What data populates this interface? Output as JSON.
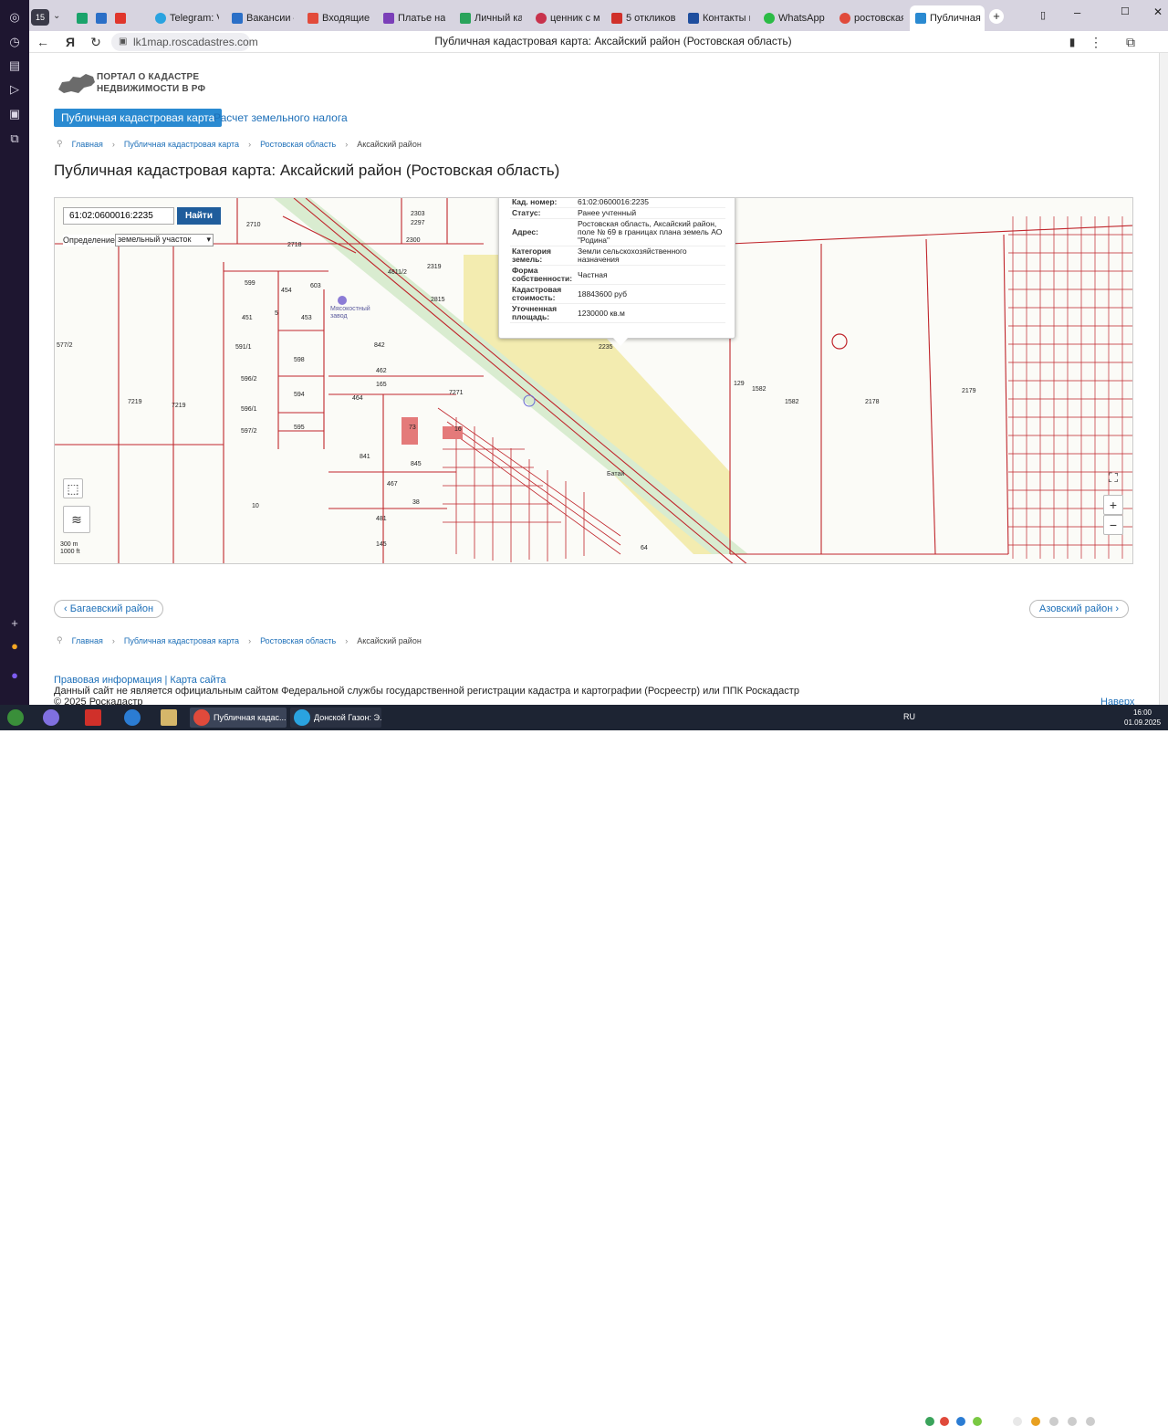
{
  "browser": {
    "tab_count_badge": "15",
    "tabs": [
      {
        "label": "Telegram: Viє",
        "color": "#2aa3e0"
      },
      {
        "label": "Вакансии – П",
        "color": "#2b6fc7"
      },
      {
        "label": "Входящие –",
        "color": "#e24b3b"
      },
      {
        "label": "Платье наря",
        "color": "#7b3fb8"
      },
      {
        "label": "Личный каби",
        "color": "#2aa35b"
      },
      {
        "label": "ценник с мар",
        "color": "#c8324c"
      },
      {
        "label": "5 откликов",
        "color": "#d0302a"
      },
      {
        "label": "Контакты в Р",
        "color": "#1f4e9e"
      },
      {
        "label": "WhatsApp",
        "color": "#2bbb45"
      },
      {
        "label": "ростовская о",
        "color": "#e04a3b"
      },
      {
        "label": "Публичная",
        "color": "#2a8ad1"
      }
    ],
    "url": "lk1map.roscadastres.com",
    "page_title": "Публичная кадастровая карта: Аксайский район (Ростовская область)"
  },
  "site": {
    "logo_line1": "ПОРТАЛ О КАДАСТРЕ",
    "logo_line2": "НЕДВИЖИМОСТИ В РФ",
    "tab_cadastral": "Публичная кадастровая карта",
    "tab_tax": "Расчет земельного налога",
    "breadcrumbs": [
      "Главная",
      "Публичная кадастровая карта",
      "Ростовская область",
      "Аксайский район"
    ],
    "heading": "Публичная кадастровая карта: Аксайский район (Ростовская область)"
  },
  "map": {
    "search_value": "61:02:0600016:2235",
    "search_button": "Найти",
    "definition_label": "Определение:",
    "definition_value": "земельный участок",
    "popup": [
      {
        "key": "Кад. номер:",
        "value": "61:02:0600016:2235"
      },
      {
        "key": "Статус:",
        "value": "Ранее учтенный"
      },
      {
        "key": "Адрес:",
        "value": "Ростовская область, Аксайский район, поле № 69 в границах плана земель АО \"Родина\""
      },
      {
        "key": "Категория земель:",
        "value": "Земли сельскохозяйственного назначения"
      },
      {
        "key": "Форма собственности:",
        "value": "Частная"
      },
      {
        "key": "Кадастровая стоимость:",
        "value": "18843600 руб"
      },
      {
        "key": "Уточненная площадь:",
        "value": "1230000 кв.м"
      }
    ],
    "parcel_labels": [
      "2710",
      "2303",
      "2297",
      "2300",
      "2718",
      "2319",
      "4811/2",
      "2815",
      "599",
      "454",
      "603",
      "451",
      "5",
      "453",
      "577/2",
      "591/1",
      "842",
      "598",
      "596/2",
      "462",
      "165",
      "594",
      "464",
      "7219",
      "7219",
      "596/1",
      "7271",
      "73",
      "16",
      "597/2",
      "595",
      "841",
      "845",
      "467",
      "38",
      "10",
      "481",
      "145",
      "2235",
      "129",
      "1582",
      "1582",
      "2178",
      "2179",
      "64"
    ],
    "place_labels": [
      "Мясокостный завод",
      "Батай"
    ],
    "scale_m": "300 m",
    "scale_ft": "1000 ft",
    "zoom_in": "+",
    "zoom_out": "−"
  },
  "pager": {
    "prev": "Багаевский район",
    "next": "Азовский район"
  },
  "footer": {
    "links": "Правовая информация | Карта сайта",
    "disclaimer": "Данный сайт не является официальным сайтом Федеральной службы государственной регистрации кадастра и картографии (Росреестр) или ППК Роскадастр",
    "copyright": "© 2025 Роскадастр",
    "up": "Наверх"
  },
  "taskbar": {
    "apps": [
      "Публичная кадас...",
      "Донской Газон: Э..."
    ],
    "lang": "RU",
    "time": "16:00",
    "date": "01.09.2025"
  }
}
